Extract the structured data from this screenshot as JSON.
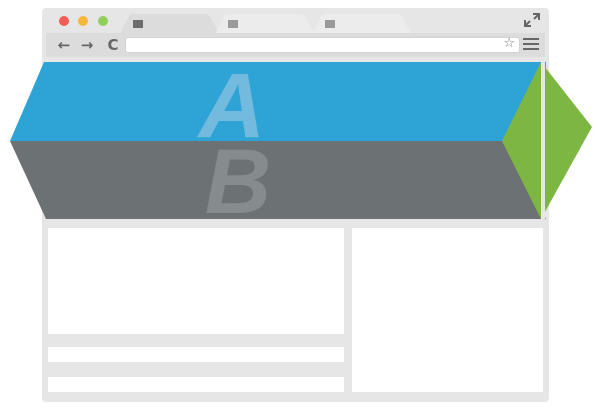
{
  "browser": {
    "window_controls": [
      "close",
      "minimize",
      "maximize"
    ],
    "control_colors": [
      "#f25c54",
      "#f5b73b",
      "#8fcf5a"
    ],
    "tabs": [
      {
        "icon": "page-icon",
        "active": true
      },
      {
        "icon": "page-icon",
        "active": false
      },
      {
        "icon": "page-icon",
        "active": false
      }
    ],
    "nav": {
      "back": "←",
      "forward": "→",
      "reload": "C",
      "bookmark": "☆"
    },
    "address": ""
  },
  "hero": {
    "top_band": {
      "letter": "A",
      "color": "#2ea3d5"
    },
    "bottom_band": {
      "letter": "B",
      "color": "#6c7173"
    },
    "side_arrow_color": "#7db642"
  },
  "colors": {
    "frame": "#e6e6e6",
    "tab_inactive": "#ececec",
    "content": "#ffffff"
  }
}
